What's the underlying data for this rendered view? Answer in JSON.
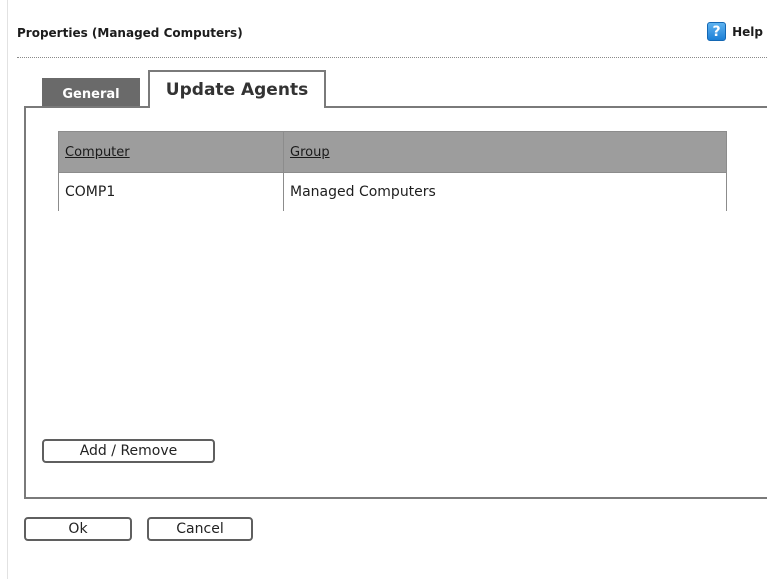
{
  "header": {
    "title": "Properties (Managed Computers)",
    "help_label": "Help",
    "help_icon": "help-question-icon"
  },
  "tabs": [
    {
      "label": "General",
      "active": false
    },
    {
      "label": "Update Agents",
      "active": true
    }
  ],
  "table": {
    "columns": [
      "Computer",
      "Group"
    ],
    "rows": [
      [
        "COMP1",
        "Managed Computers"
      ]
    ]
  },
  "buttons": {
    "add_remove": "Add / Remove",
    "ok": "Ok",
    "cancel": "Cancel"
  },
  "colors": {
    "help_icon": "#2a8ee0",
    "tab_inactive": "#6a6a6a",
    "grid_header": "#9d9d9d",
    "border": "#7a7a7a"
  }
}
